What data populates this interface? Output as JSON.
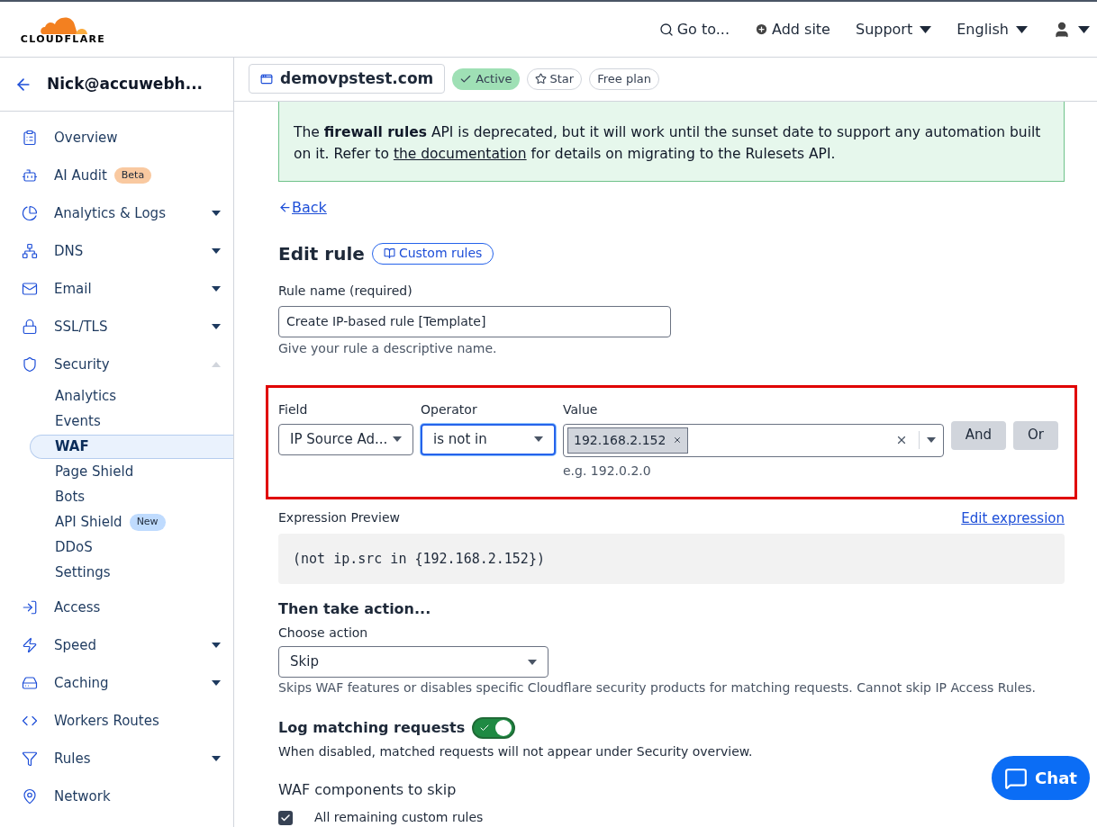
{
  "header": {
    "brand": "CLOUDFLARE",
    "nav": [
      {
        "kind": "search",
        "label": "Go to..."
      },
      {
        "kind": "add",
        "label": "Add site"
      },
      {
        "kind": "menu",
        "label": "Support"
      },
      {
        "kind": "menu",
        "label": "English"
      },
      {
        "kind": "user"
      }
    ]
  },
  "sidebar": {
    "account": "Nick@accuwebh...",
    "items": [
      {
        "label": "Overview",
        "kind": "link"
      },
      {
        "label": "AI Audit",
        "kind": "link",
        "badge": {
          "text": "Beta",
          "color": "#f9c9a0"
        }
      },
      {
        "label": "Analytics & Logs",
        "kind": "group",
        "expanded": false
      },
      {
        "label": "DNS",
        "kind": "group",
        "expanded": false
      },
      {
        "label": "Email",
        "kind": "group",
        "expanded": false
      },
      {
        "label": "SSL/TLS",
        "kind": "group",
        "expanded": false
      },
      {
        "label": "Security",
        "kind": "group",
        "expanded": true,
        "children": [
          {
            "label": "Analytics",
            "selected": false
          },
          {
            "label": "Events",
            "selected": false
          },
          {
            "label": "WAF",
            "selected": true
          },
          {
            "label": "Page Shield",
            "selected": false
          },
          {
            "label": "Bots",
            "selected": false
          },
          {
            "label": "API Shield",
            "selected": false,
            "badge": {
              "text": "New",
              "color": "#bfdbfe"
            }
          },
          {
            "label": "DDoS",
            "selected": false
          },
          {
            "label": "Settings",
            "selected": false
          }
        ]
      },
      {
        "label": "Access",
        "kind": "link"
      },
      {
        "label": "Speed",
        "kind": "group",
        "expanded": false
      },
      {
        "label": "Caching",
        "kind": "group",
        "expanded": false
      },
      {
        "label": "Workers Routes",
        "kind": "link"
      },
      {
        "label": "Rules",
        "kind": "group",
        "expanded": false
      },
      {
        "label": "Network",
        "kind": "link"
      }
    ]
  },
  "domain_bar": {
    "domain": "demovpstest.com",
    "status": "Active",
    "star": "Star",
    "plan": "Free plan"
  },
  "banner": {
    "text": "The **firewall rules** API is deprecated, but it will work until the sunset date to support any automation built on it. Refer to ",
    "link": "the documentation",
    "text_after": " for details on migrating to the Rulesets API."
  },
  "back_link": "Back",
  "title": "Edit rule",
  "title_button": "Custom rules",
  "rule_name": {
    "label": "Rule name (required)",
    "value": "Create IP-based rule [Template]",
    "help": "Give your rule a descriptive name."
  },
  "condition": {
    "field_label": "Field",
    "field_value": "IP Source Ad...",
    "operator_label": "Operator",
    "operator_value": "is not in",
    "value_label": "Value",
    "tags": [
      "192.168.2.152"
    ],
    "value_help": "e.g. 192.0.2.0",
    "buttons": [
      "And",
      "Or"
    ]
  },
  "expression": {
    "label": "Expression Preview",
    "edit_link": "Edit expression",
    "code": "(not ip.src in {192.168.2.152})"
  },
  "action": {
    "heading": "Then take action...",
    "label": "Choose action",
    "value": "Skip",
    "help": "Skips WAF features or disables specific Cloudflare security products for matching requests. Cannot skip IP Access Rules."
  },
  "logging": {
    "label": "Log matching requests",
    "on": true,
    "help": "When disabled, matched requests will not appear under Security overview."
  },
  "skip": {
    "heading": "WAF components to skip",
    "options": [
      {
        "label": "All remaining custom rules",
        "checked": true
      }
    ]
  },
  "chat": "Chat"
}
